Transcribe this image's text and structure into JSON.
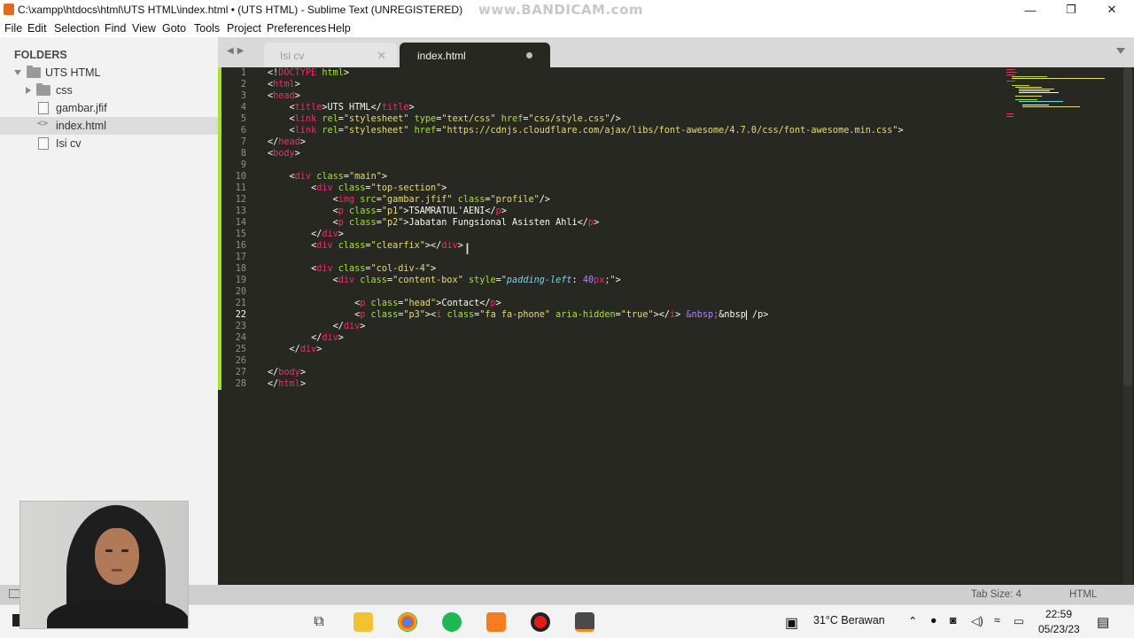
{
  "window": {
    "title": "C:\\xampp\\htdocs\\html\\UTS HTML\\index.html • (UTS HTML) - Sublime Text (UNREGISTERED)",
    "watermark": "www.BANDICAM.com",
    "controls": {
      "minimize": "—",
      "maximize": "❐",
      "close": "✕"
    }
  },
  "menu": [
    "File",
    "Edit",
    "Selection",
    "Find",
    "View",
    "Goto",
    "Tools",
    "Project",
    "Preferences",
    "Help"
  ],
  "sidebar": {
    "heading": "FOLDERS",
    "root": "UTS HTML",
    "items": [
      {
        "label": "css",
        "type": "folder"
      },
      {
        "label": "gambar.jfif",
        "type": "file"
      },
      {
        "label": "index.html",
        "type": "code",
        "selected": true
      },
      {
        "label": "Isi cv",
        "type": "file"
      }
    ]
  },
  "tabs": [
    {
      "label": "Isi cv",
      "active": false
    },
    {
      "label": "index.html",
      "active": true,
      "dirty": true
    }
  ],
  "editor": {
    "line_numbers": [
      "1",
      "2",
      "3",
      "4",
      "5",
      "6",
      "7",
      "8",
      "9",
      "10",
      "11",
      "12",
      "13",
      "14",
      "15",
      "16",
      "17",
      "18",
      "19",
      "20",
      "21",
      "22",
      "23",
      "24",
      "25",
      "26",
      "27",
      "28"
    ],
    "current_line": 22
  },
  "code": {
    "l1": [
      "<!",
      "DOCTYPE",
      " html",
      ">"
    ],
    "l2": [
      "<",
      "html",
      ">"
    ],
    "l3": [
      "<",
      "head",
      ">"
    ],
    "l4": [
      "    <",
      "title",
      ">UTS HTML</",
      "title",
      ">"
    ],
    "l5": [
      "    <",
      "link",
      " rel",
      "=",
      "\"stylesheet\"",
      " type",
      "=",
      "\"text/css\"",
      " href",
      "=",
      "\"css/style.css\"",
      "/>"
    ],
    "l6": [
      "    <",
      "link",
      " rel",
      "=",
      "\"stylesheet\"",
      " href",
      "=",
      "\"https://cdnjs.cloudflare.com/ajax/libs/font-awesome/4.7.0/css/font-awesome.min.css\"",
      ">"
    ],
    "l7": [
      "</",
      "head",
      ">"
    ],
    "l8": [
      "<",
      "body",
      ">"
    ],
    "l10": [
      "    <",
      "div",
      " class",
      "=",
      "\"main\"",
      ">"
    ],
    "l11": [
      "        <",
      "div",
      " class",
      "=",
      "\"top-section\"",
      ">"
    ],
    "l12": [
      "            <",
      "img",
      " src",
      "=",
      "\"gambar.jfif\"",
      " class",
      "=",
      "\"profile\"",
      "/>"
    ],
    "l13": [
      "            <",
      "p",
      " class",
      "=",
      "\"p1\"",
      ">TSAMRATUL'AENI</",
      "p",
      ">"
    ],
    "l14": [
      "            <",
      "p",
      " class",
      "=",
      "\"p2\"",
      ">Jabatan Fungsional Asisten Ahli</",
      "p",
      ">"
    ],
    "l15": [
      "        </",
      "div",
      ">"
    ],
    "l16": [
      "        <",
      "div",
      " class",
      "=",
      "\"clearfix\"",
      "></",
      "div",
      ">"
    ],
    "l18": [
      "        <",
      "div",
      " class",
      "=",
      "\"col-div-4\"",
      ">"
    ],
    "l19": [
      "            <",
      "div",
      " class",
      "=",
      "\"content-box\"",
      " style",
      "=",
      "\"",
      "padding-left",
      ": ",
      "40",
      "px",
      ";\"",
      ">"
    ],
    "l21": [
      "                <",
      "p",
      " class",
      "=",
      "\"head\"",
      ">Contact</",
      "p",
      ">"
    ],
    "l22": [
      "                <",
      "p",
      " class",
      "=",
      "\"p3\"",
      "><",
      "i",
      " class",
      "=",
      "\"fa fa-phone\"",
      " aria-hidden",
      "=",
      "\"true\"",
      "></",
      "i",
      "> ",
      "&nbsp;",
      "&nbsp",
      " /p>"
    ],
    "l23": [
      "            </",
      "div",
      ">"
    ],
    "l24": [
      "        </",
      "div",
      ">"
    ],
    "l25": [
      "    </",
      "div",
      ">"
    ],
    "l27": [
      "</",
      "body",
      ">"
    ],
    "l28": [
      "</",
      "html",
      ">"
    ]
  },
  "status": {
    "tab_size": "Tab Size: 4",
    "syntax": "HTML"
  },
  "taskbar": {
    "search_fragment": "h",
    "weather": "31°C  Berawan",
    "time": "22:59",
    "date": "05/23/23"
  },
  "colors": {
    "editor_bg": "#272822",
    "tag": "#f92672",
    "attr": "#a6e22e",
    "string": "#e6db74",
    "number": "#ae81ff",
    "property": "#66d9ef"
  }
}
